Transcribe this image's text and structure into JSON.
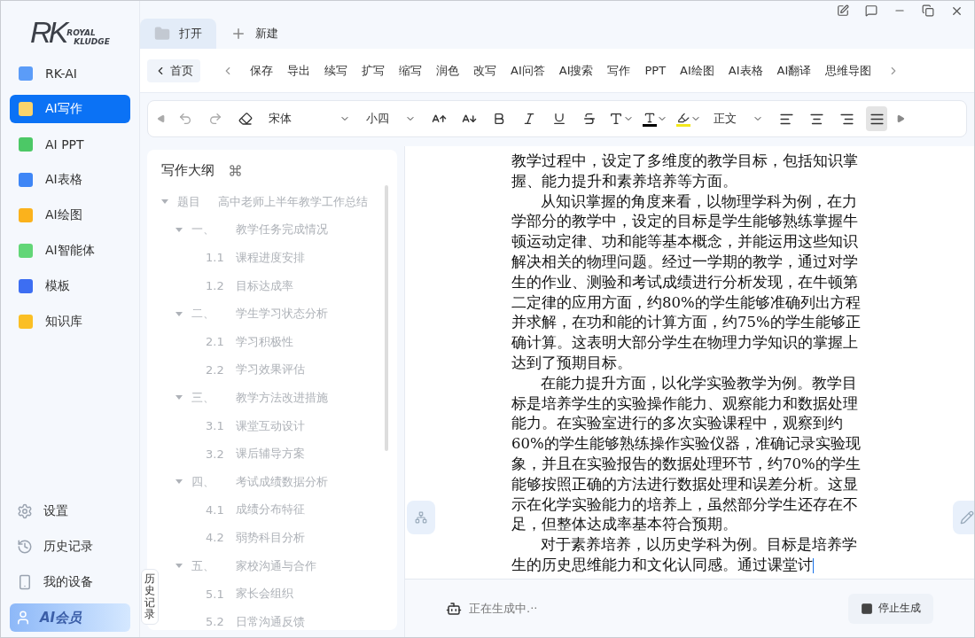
{
  "logo": {
    "mark": "RK",
    "line1": "ROYAL",
    "line2": "KLUDGE"
  },
  "sidebar": {
    "items": [
      {
        "label": "RK-AI",
        "color": "#5b9cf8",
        "selected": false
      },
      {
        "label": "AI写作",
        "color": "#fbd46b",
        "selected": true
      },
      {
        "label": "AI PPT",
        "color": "#4cc866",
        "selected": false
      },
      {
        "label": "AI表格",
        "color": "#3e86f6",
        "selected": false
      },
      {
        "label": "AI绘图",
        "color": "#fbb21c",
        "selected": false
      },
      {
        "label": "AI智能体",
        "color": "#62d677",
        "selected": false
      },
      {
        "label": "模板",
        "color": "#3d6ef2",
        "selected": false
      },
      {
        "label": "知识库",
        "color": "#fbbf24",
        "selected": false
      }
    ],
    "bottom": [
      {
        "kind": "settings",
        "label": "设置"
      },
      {
        "kind": "history",
        "label": "历史记录"
      },
      {
        "kind": "device",
        "label": "我的设备"
      }
    ],
    "member": "AI会员"
  },
  "tabs": [
    {
      "label": "打开",
      "kind": "open",
      "selected": true
    },
    {
      "label": "新建",
      "kind": "new",
      "selected": false
    }
  ],
  "ribbon": {
    "home": "首页",
    "items": [
      "保存",
      "导出",
      "续写",
      "扩写",
      "缩写",
      "润色",
      "改写",
      "AI问答",
      "AI搜索",
      "写作",
      "PPT",
      "AI绘图",
      "AI表格",
      "AI翻译",
      "思维导图"
    ]
  },
  "format": {
    "font": "宋体",
    "size": "小四",
    "style": "正文",
    "align": [
      {
        "kind": "left",
        "selected": false
      },
      {
        "kind": "center",
        "selected": false
      },
      {
        "kind": "right",
        "selected": false
      },
      {
        "kind": "justify",
        "selected": true
      }
    ]
  },
  "outline": {
    "title": "写作大纲",
    "tree": {
      "label": "题目",
      "text": "高中老师上半年教学工作总结",
      "expanded": true,
      "children": [
        {
          "label": "一、",
          "text": "教学任务完成情况",
          "expanded": true,
          "children": [
            {
              "label": "1.1",
              "text": "课程进度安排"
            },
            {
              "label": "1.2",
              "text": "目标达成率"
            }
          ]
        },
        {
          "label": "二、",
          "text": "学生学习状态分析",
          "expanded": true,
          "children": [
            {
              "label": "2.1",
              "text": "学习积极性"
            },
            {
              "label": "2.2",
              "text": "学习效果评估"
            }
          ]
        },
        {
          "label": "三、",
          "text": "教学方法改进措施",
          "expanded": true,
          "children": [
            {
              "label": "3.1",
              "text": "课堂互动设计"
            },
            {
              "label": "3.2",
              "text": "课后辅导方案"
            }
          ]
        },
        {
          "label": "四、",
          "text": "考试成绩数据分析",
          "expanded": true,
          "children": [
            {
              "label": "4.1",
              "text": "成绩分布特征"
            },
            {
              "label": "4.2",
              "text": "弱势科目分析"
            }
          ]
        },
        {
          "label": "五、",
          "text": "家校沟通与合作",
          "expanded": true,
          "children": [
            {
              "label": "5.1",
              "text": "家长会组织"
            },
            {
              "label": "5.2",
              "text": "日常沟通反馈"
            }
          ]
        }
      ]
    }
  },
  "history_tab": "历史记录",
  "document": {
    "paragraphs": [
      {
        "indent": false,
        "text": "教学过程中，设定了多维度的教学目标，包括知识掌握、能力提升和素养培养等方面。"
      },
      {
        "indent": true,
        "text": "从知识掌握的角度来看，以物理学科为例，在力学部分的教学中，设定的目标是学生能够熟练掌握牛顿运动定律、功和能等基本概念，并能运用这些知识解决相关的物理问题。经过一学期的教学，通过对学生的作业、测验和考试成绩进行分析发现，在牛顿第二定律的应用方面，约80%的学生能够准确列出方程并求解，在功和能的计算方面，约75%的学生能够正确计算。这表明大部分学生在物理力学知识的掌握上达到了预期目标。"
      },
      {
        "indent": true,
        "text": "在能力提升方面，以化学实验教学为例。教学目标是培养学生的实验操作能力、观察能力和数据处理能力。在实验室进行的多次实验课程中，观察到约60%的学生能够熟练操作实验仪器，准确记录实验现象，并且在实验报告的数据处理环节，约70%的学生能够按照正确的方法进行数据处理和误差分析。这显示在化学实验能力的培养上，虽然部分学生还存在不足，但整体达成率基本符合预期。"
      },
      {
        "indent": true,
        "text": "对于素养培养，以历史学科为例。目标是培养学生的历史思维能力和文化认同感。通过课堂讨"
      }
    ]
  },
  "status": {
    "text": "正在生成中.··",
    "stop": "停止生成"
  }
}
